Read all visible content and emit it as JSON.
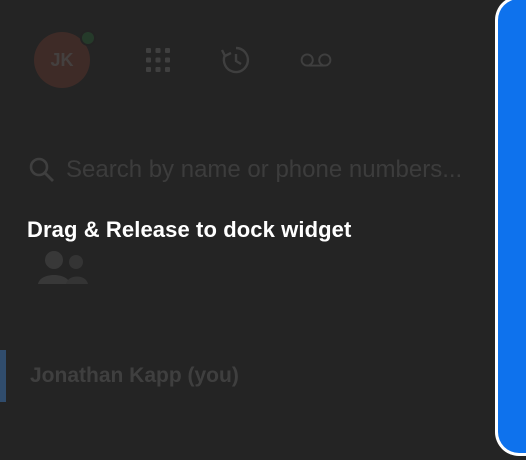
{
  "widget": {
    "avatar_initials": "JK",
    "presence_color": "#2fb24d",
    "avatar_color": "#c8553d",
    "toolbar_icons": [
      "keypad-icon",
      "call-history-icon",
      "voicemail-icon"
    ],
    "search": {
      "placeholder": "Search by name or phone numbers..."
    },
    "contact": {
      "name": "Jonathan Kapp (you)"
    }
  },
  "overlay": {
    "message": "Drag & Release to dock widget",
    "dock_color": "#0e72ed"
  }
}
